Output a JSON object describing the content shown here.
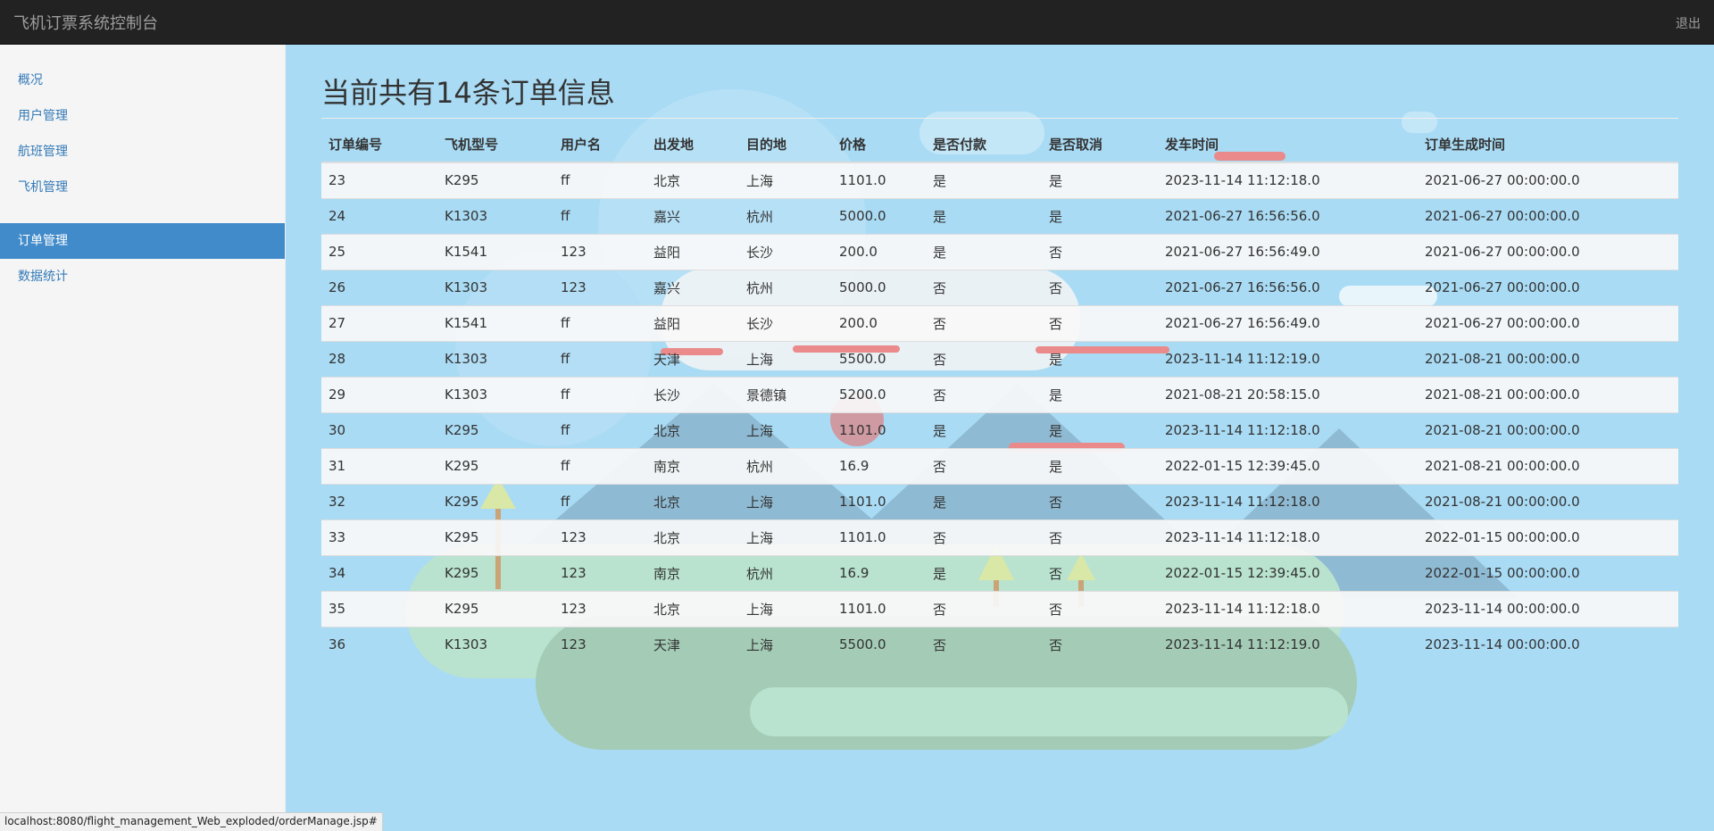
{
  "app": {
    "title": "飞机订票系统控制台",
    "logout_label": "退出"
  },
  "sidebar": {
    "items": [
      {
        "label": "概况"
      },
      {
        "label": "用户管理"
      },
      {
        "label": "航班管理"
      },
      {
        "label": "飞机管理"
      },
      {
        "label": "订单管理",
        "active": true
      },
      {
        "label": "数据统计"
      }
    ]
  },
  "main": {
    "title": "当前共有14条订单信息",
    "columns": [
      "订单编号",
      "飞机型号",
      "用户名",
      "出发地",
      "目的地",
      "价格",
      "是否付款",
      "是否取消",
      "发车时间",
      "订单生成时间"
    ],
    "rows": [
      [
        "23",
        "K295",
        "ff",
        "北京",
        "上海",
        "1101.0",
        "是",
        "是",
        "2023-11-14 11:12:18.0",
        "2021-06-27 00:00:00.0"
      ],
      [
        "24",
        "K1303",
        "ff",
        "嘉兴",
        "杭州",
        "5000.0",
        "是",
        "是",
        "2021-06-27 16:56:56.0",
        "2021-06-27 00:00:00.0"
      ],
      [
        "25",
        "K1541",
        "123",
        "益阳",
        "长沙",
        "200.0",
        "是",
        "否",
        "2021-06-27 16:56:49.0",
        "2021-06-27 00:00:00.0"
      ],
      [
        "26",
        "K1303",
        "123",
        "嘉兴",
        "杭州",
        "5000.0",
        "否",
        "否",
        "2021-06-27 16:56:56.0",
        "2021-06-27 00:00:00.0"
      ],
      [
        "27",
        "K1541",
        "ff",
        "益阳",
        "长沙",
        "200.0",
        "否",
        "否",
        "2021-06-27 16:56:49.0",
        "2021-06-27 00:00:00.0"
      ],
      [
        "28",
        "K1303",
        "ff",
        "天津",
        "上海",
        "5500.0",
        "否",
        "是",
        "2023-11-14 11:12:19.0",
        "2021-08-21 00:00:00.0"
      ],
      [
        "29",
        "K1303",
        "ff",
        "长沙",
        "景德镇",
        "5200.0",
        "否",
        "是",
        "2021-08-21 20:58:15.0",
        "2021-08-21 00:00:00.0"
      ],
      [
        "30",
        "K295",
        "ff",
        "北京",
        "上海",
        "1101.0",
        "是",
        "是",
        "2023-11-14 11:12:18.0",
        "2021-08-21 00:00:00.0"
      ],
      [
        "31",
        "K295",
        "ff",
        "南京",
        "杭州",
        "16.9",
        "否",
        "是",
        "2022-01-15 12:39:45.0",
        "2021-08-21 00:00:00.0"
      ],
      [
        "32",
        "K295",
        "ff",
        "北京",
        "上海",
        "1101.0",
        "是",
        "否",
        "2023-11-14 11:12:18.0",
        "2021-08-21 00:00:00.0"
      ],
      [
        "33",
        "K295",
        "123",
        "北京",
        "上海",
        "1101.0",
        "否",
        "否",
        "2023-11-14 11:12:18.0",
        "2022-01-15 00:00:00.0"
      ],
      [
        "34",
        "K295",
        "123",
        "南京",
        "杭州",
        "16.9",
        "是",
        "否",
        "2022-01-15 12:39:45.0",
        "2022-01-15 00:00:00.0"
      ],
      [
        "35",
        "K295",
        "123",
        "北京",
        "上海",
        "1101.0",
        "否",
        "否",
        "2023-11-14 11:12:18.0",
        "2023-11-14 00:00:00.0"
      ],
      [
        "36",
        "K1303",
        "123",
        "天津",
        "上海",
        "5500.0",
        "否",
        "否",
        "2023-11-14 11:12:19.0",
        "2023-11-14 00:00:00.0"
      ]
    ]
  },
  "status_bar": {
    "url": "localhost:8080/flight_management_Web_exploded/orderManage.jsp#"
  },
  "colors": {
    "navbar": "#222222",
    "sidebar": "#f5f5f5",
    "active_nav": "#428bca",
    "link": "#337ab7",
    "background": "#a9dbf4"
  }
}
